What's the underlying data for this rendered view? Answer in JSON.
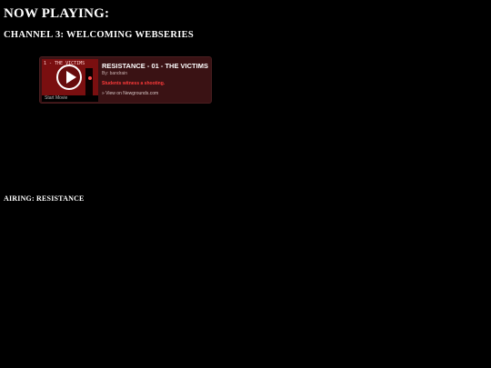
{
  "header": {
    "title": "NOW PLAYING:",
    "channel": "CHANNEL 3: WELCOMING WEBSERIES"
  },
  "embed": {
    "thumbnail_title": "1 - THE VICTIMS",
    "start_label": "Start Movie",
    "movie_title": "RESISTANCE - 01 - THE VICTIMS",
    "author": "By: bandrain",
    "description": "Students witness a shooting.",
    "link_text": "» View on Newgrounds.com",
    "play_icon": "play-circle-icon"
  },
  "footer": {
    "airing": "AIRING: RESISTANCE"
  },
  "colors": {
    "background": "#000000",
    "embed_background": "#3a1214",
    "thumbnail_red": "#7a0f10",
    "description_red": "#ff3a3a"
  }
}
